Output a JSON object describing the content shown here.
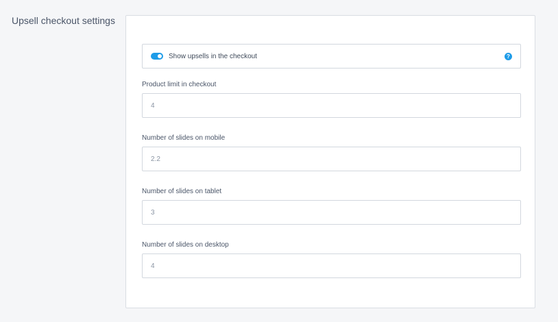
{
  "section": {
    "title": "Upsell checkout settings"
  },
  "toggle": {
    "label": "Show upsells in the checkout",
    "enabled": true,
    "help_icon": "question-circle-icon",
    "accent_color": "#1e9ce8"
  },
  "fields": {
    "product_limit": {
      "label": "Product limit in checkout",
      "value": "4"
    },
    "slides_mobile": {
      "label": "Number of slides on mobile",
      "value": "2.2"
    },
    "slides_tablet": {
      "label": "Number of slides on tablet",
      "value": "3"
    },
    "slides_desktop": {
      "label": "Number of slides on desktop",
      "value": "4"
    }
  }
}
